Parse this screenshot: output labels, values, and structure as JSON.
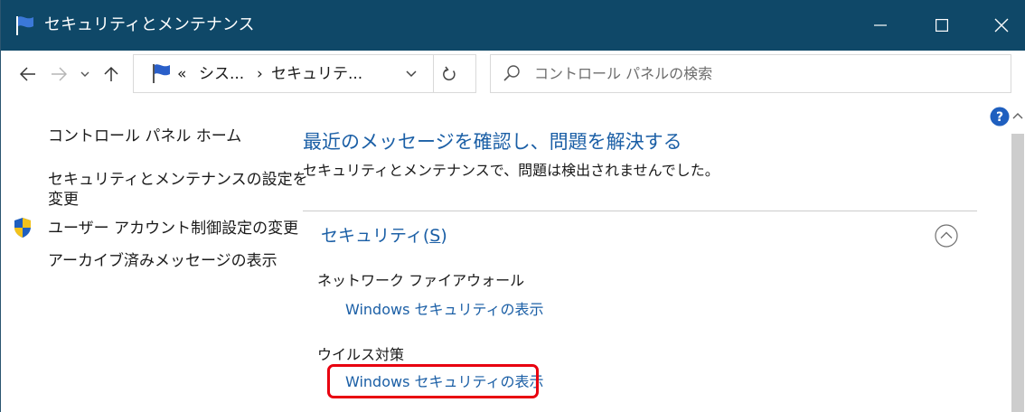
{
  "window": {
    "title": "セキュリティとメンテナンス",
    "minimize_label": "Minimize",
    "maximize_label": "Maximize",
    "close_label": "Close",
    "titlebar_color": "#0f4868"
  },
  "navbar": {
    "back_icon": "arrow-left-icon",
    "forward_icon": "arrow-right-icon",
    "recent_icon": "chevron-down-icon",
    "up_icon": "arrow-up-icon",
    "address": {
      "prefix": "«",
      "crumb1": "シス...",
      "separator": "›",
      "crumb2": "セキュリテ..."
    },
    "refresh_icon": "refresh-icon",
    "search": {
      "placeholder": "コントロール パネルの検索"
    }
  },
  "left_pane": {
    "home_link": "コントロール パネル ホーム",
    "settings_link_line1": "セキュリティとメンテナンスの設定を",
    "settings_link_line2": "変更",
    "uac_link": "ユーザー アカウント制御設定の変更",
    "archive_link": "アーカイブ済みメッセージの表示"
  },
  "main": {
    "heading": "最近のメッセージを確認し、問題を解決する",
    "subtext": "セキュリティとメンテナンスで、問題は検出されませんでした。",
    "security_section": {
      "title_prefix": "セキュリティ(",
      "title_key": "S",
      "title_suffix": ")",
      "items": [
        {
          "label": "ネットワーク ファイアウォール",
          "link": "Windows セキュリティの表示"
        },
        {
          "label": "ウイルス対策",
          "link": "Windows セキュリティの表示"
        }
      ]
    },
    "link_color": "#1b5fa6",
    "highlight_color": "#e8000f"
  }
}
